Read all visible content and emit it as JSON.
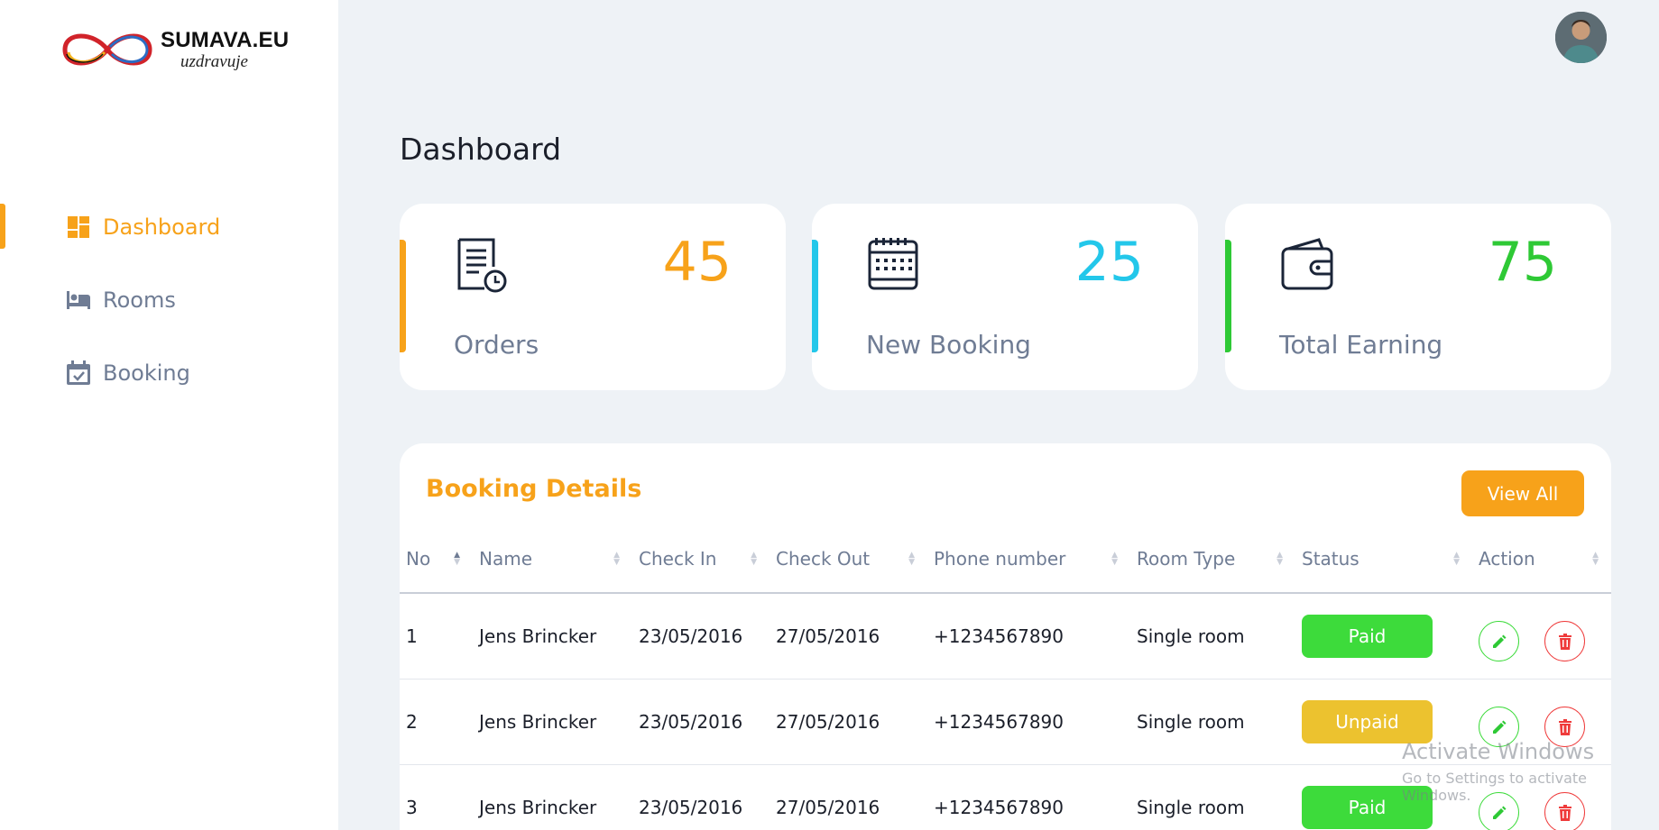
{
  "brand": {
    "name": "SUMAVA.EU",
    "tagline": "uzdravuje"
  },
  "sidebar": {
    "items": [
      {
        "label": "Dashboard",
        "icon": "dashboard-icon",
        "active": true
      },
      {
        "label": "Rooms",
        "icon": "bed-icon",
        "active": false
      },
      {
        "label": "Booking",
        "icon": "calendar-check-icon",
        "active": false
      }
    ]
  },
  "header": {
    "title": "Dashboard",
    "avatar": "user-avatar"
  },
  "stats": [
    {
      "label": "Orders",
      "value": "45",
      "color": "#f7a21a",
      "icon": "receipt-icon"
    },
    {
      "label": "New Booking",
      "value": "25",
      "color": "#23c7ea",
      "icon": "calendar-icon"
    },
    {
      "label": "Total Earning",
      "value": "75",
      "color": "#2ec935",
      "icon": "wallet-icon"
    }
  ],
  "booking": {
    "title": "Booking Details",
    "view_all": "View All",
    "columns": [
      "No",
      "Name",
      "Check In",
      "Check Out",
      "Phone number",
      "Room Type",
      "Status",
      "Action"
    ],
    "rows": [
      {
        "no": "1",
        "name": "Jens Brincker",
        "check_in": "23/05/2016",
        "check_out": "27/05/2016",
        "phone": "+1234567890",
        "room_type": "Single room",
        "status": "Paid"
      },
      {
        "no": "2",
        "name": "Jens Brincker",
        "check_in": "23/05/2016",
        "check_out": "27/05/2016",
        "phone": "+1234567890",
        "room_type": "Single room",
        "status": "Unpaid"
      },
      {
        "no": "3",
        "name": "Jens Brincker",
        "check_in": "23/05/2016",
        "check_out": "27/05/2016",
        "phone": "+1234567890",
        "room_type": "Single room",
        "status": "Paid"
      }
    ]
  },
  "watermark": {
    "title": "Activate Windows",
    "subtitle": "Go to Settings to activate Windows."
  },
  "colors": {
    "accent": "#f7a21a",
    "paid": "#3ddb3b",
    "unpaid": "#ecc22f",
    "delete": "#ef3b3b"
  }
}
